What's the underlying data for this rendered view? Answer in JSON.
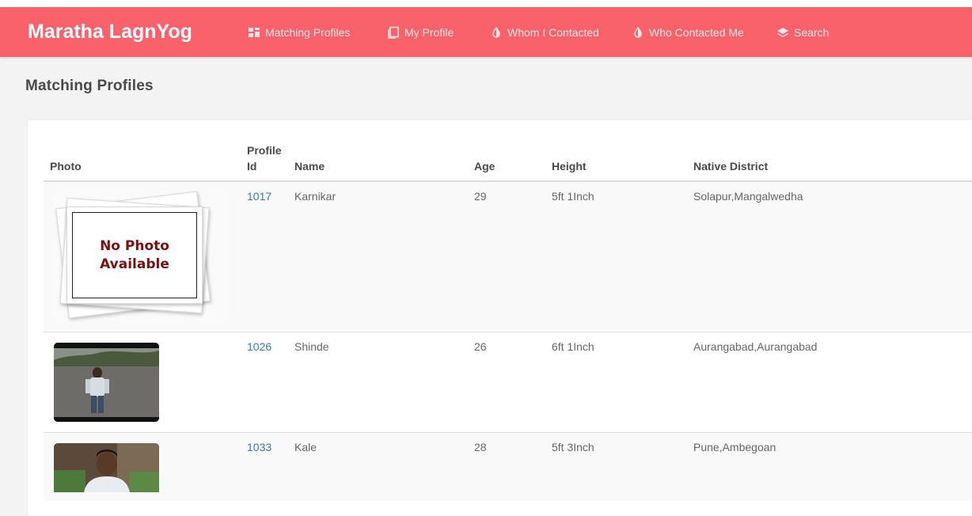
{
  "app": {
    "brand": "Maratha LagnYog"
  },
  "nav": {
    "items": [
      {
        "label": "Matching Profiles",
        "icon": "dashboard-icon"
      },
      {
        "label": "My Profile",
        "icon": "copy-icon"
      },
      {
        "label": "Whom I Contacted",
        "icon": "contrast-icon"
      },
      {
        "label": "Who Contacted Me",
        "icon": "contrast-icon"
      },
      {
        "label": "Search",
        "icon": "layers-icon"
      }
    ]
  },
  "page": {
    "title": "Matching Profiles"
  },
  "table": {
    "headers": {
      "photo": "Photo",
      "profile_id_line1": "Profile",
      "profile_id_line2": "Id",
      "name": "Name",
      "age": "Age",
      "height": "Height",
      "native_district": "Native District"
    },
    "rows": [
      {
        "profile_id": "1017",
        "name": "Karnikar",
        "age": "29",
        "height": "5ft 1Inch",
        "native_district": "Solapur,Mangalwedha",
        "photo": "No Photo\nAvailable"
      },
      {
        "profile_id": "1026",
        "name": "Shinde",
        "age": "26",
        "height": "6ft 1Inch",
        "native_district": "Aurangabad,Aurangabad"
      },
      {
        "profile_id": "1033",
        "name": "Kale",
        "age": "28",
        "height": "5ft 3Inch",
        "native_district": "Pune,Ambegoan"
      }
    ]
  },
  "colors": {
    "navbar": "#f9626b",
    "link": "#337ab7",
    "no_photo_text": "#7a1010"
  }
}
